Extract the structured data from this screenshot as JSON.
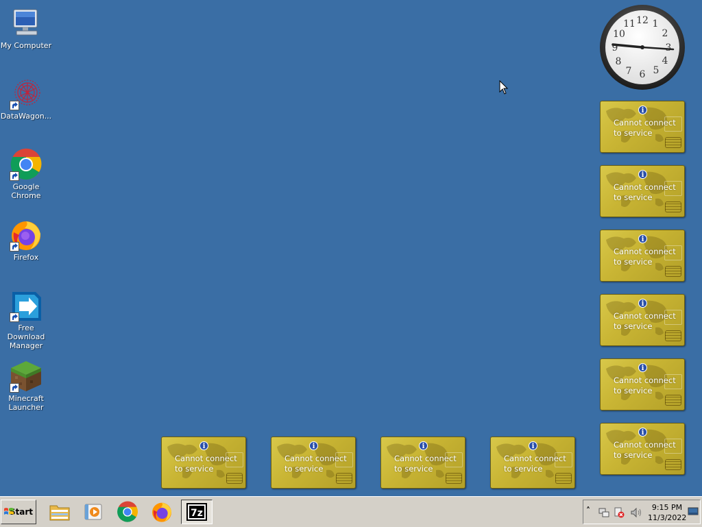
{
  "desktop": {
    "background_color": "#3a6ea5",
    "icons": [
      {
        "label_lines": [
          "My Computer",
          ""
        ],
        "icon": "my-computer-icon",
        "shortcut": false
      },
      {
        "label_lines": [
          "DataWagon...",
          ""
        ],
        "icon": "datawagon-icon",
        "shortcut": true
      },
      {
        "label_lines": [
          "Google Chrome",
          ""
        ],
        "icon": "chrome-icon",
        "shortcut": true
      },
      {
        "label_lines": [
          "Firefox",
          ""
        ],
        "icon": "firefox-icon",
        "shortcut": true
      },
      {
        "label_lines": [
          "Free Download",
          "Manager"
        ],
        "icon": "fdm-icon",
        "shortcut": true
      },
      {
        "label_lines": [
          "Minecraft",
          "Launcher"
        ],
        "icon": "minecraft-icon",
        "shortcut": true
      }
    ]
  },
  "gadgets": {
    "message_line1": "Cannot connect",
    "message_line2": "to service",
    "info_glyph": "i",
    "color": "#c9b534"
  },
  "clock": {
    "numbers": [
      "12",
      "1",
      "2",
      "3",
      "4",
      "5",
      "6",
      "7",
      "8",
      "9",
      "10",
      "11"
    ],
    "hour": 9,
    "minute": 15
  },
  "taskbar": {
    "start_label": "Start",
    "quick_launch": [
      "file-explorer-icon",
      "media-player-icon",
      "chrome-icon",
      "firefox-icon",
      "7zip-icon"
    ],
    "active_item": "7zip-icon",
    "sevenzip_text": "7z",
    "tray_icons": [
      "chevron-up-icon",
      "network-icon",
      "security-alert-icon",
      "volume-icon",
      "show-desktop-icon"
    ],
    "tray_chevron": "˄",
    "time": "9:15 PM",
    "date": "11/3/2022"
  }
}
